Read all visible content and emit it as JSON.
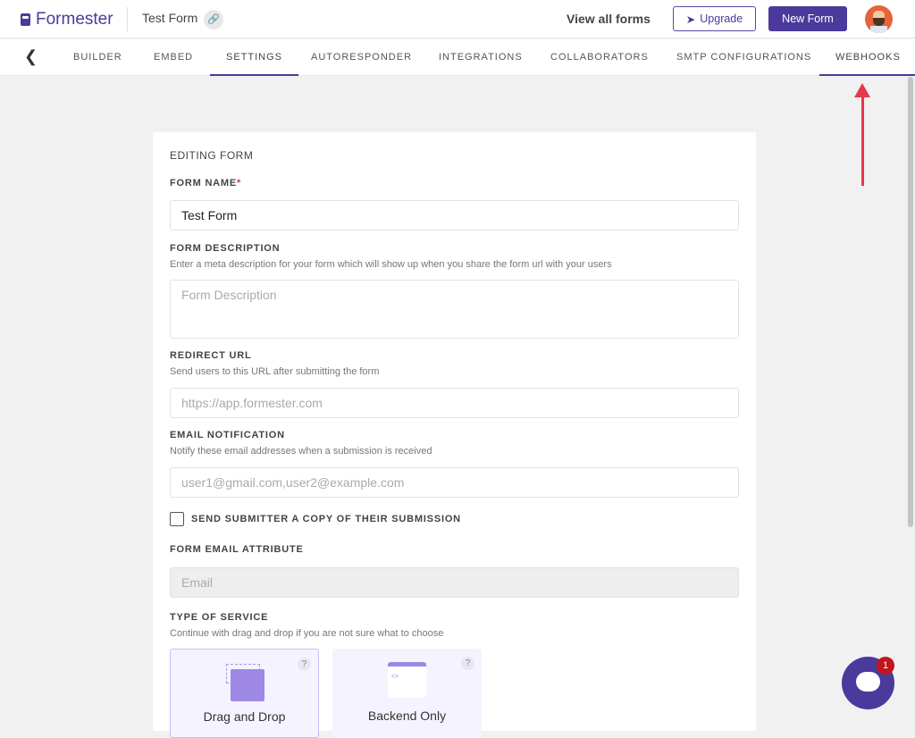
{
  "header": {
    "brand": "Formester",
    "form_title": "Test Form",
    "view_all": "View all forms",
    "upgrade": "Upgrade",
    "new_form": "New Form"
  },
  "tabs": [
    "BUILDER",
    "EMBED",
    "SETTINGS",
    "AUTORESPONDER",
    "INTEGRATIONS",
    "COLLABORATORS",
    "SMTP CONFIGURATIONS",
    "WEBHOOKS"
  ],
  "form": {
    "section": "EDITING FORM",
    "name_label": "FORM NAME",
    "required": "*",
    "name_value": "Test Form",
    "desc_label": "FORM DESCRIPTION",
    "desc_help": "Enter a meta description for your form which will show up when you share the form url with your users",
    "desc_placeholder": "Form Description",
    "redirect_label": "REDIRECT URL",
    "redirect_help": "Send users to this URL after submitting the form",
    "redirect_placeholder": "https://app.formester.com",
    "email_label": "EMAIL NOTIFICATION",
    "email_help": "Notify these email addresses when a submission is received",
    "email_placeholder": "user1@gmail.com,user2@example.com",
    "copy_label": "SEND SUBMITTER A COPY OF THEIR SUBMISSION",
    "attr_label": "FORM EMAIL ATTRIBUTE",
    "attr_placeholder": "Email",
    "service_label": "TYPE OF SERVICE",
    "service_help": "Continue with drag and drop if you are not sure what to choose",
    "services": [
      {
        "label": "Drag and Drop"
      },
      {
        "label": "Backend Only"
      }
    ],
    "help_glyph": "?"
  },
  "chat": {
    "badge": "1"
  }
}
